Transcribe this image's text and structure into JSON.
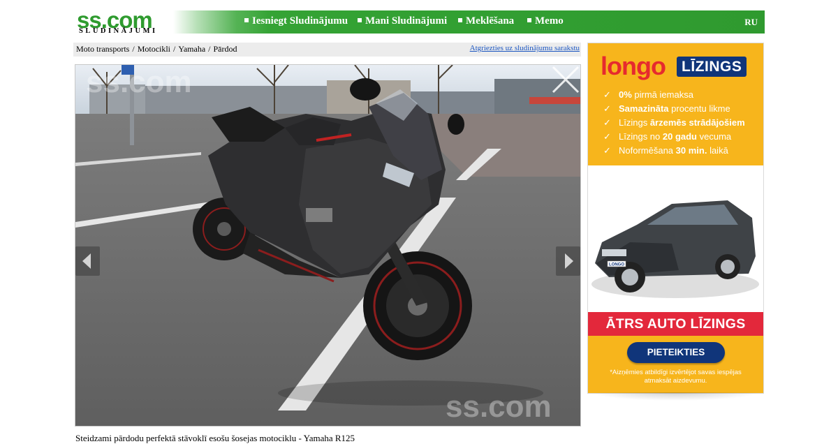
{
  "header": {
    "logo_text": "ss.com",
    "logo_subtitle": "SLUDINĀJUMI",
    "nav": [
      {
        "label": "Iesniegt Sludinājumu"
      },
      {
        "label": "Mani Sludinājumi"
      },
      {
        "label": "Meklēšana"
      },
      {
        "label": "Memo"
      }
    ],
    "language": "RU"
  },
  "breadcrumb": {
    "items": [
      "Moto transports",
      "Motocikli",
      "Yamaha",
      "Pārdod"
    ],
    "separator": "/",
    "back_link": "Atgriezties uz sludinājumu sarakstu"
  },
  "photo": {
    "subject": "black Yamaha R125 sport motorcycle in a parking lot",
    "watermark": "ss.com",
    "close_icon": "close-icon",
    "prev_icon": "chevron-left-icon",
    "next_icon": "chevron-right-icon"
  },
  "listing": {
    "description": "Steidzami pārdodu perfektā stāvoklī esošu šosejas motociklu - Yamaha R125"
  },
  "ad": {
    "brand": "longo",
    "badge": "LĪZINGS",
    "features": [
      {
        "bold": "0%",
        "text": " pirmā iemaksa"
      },
      {
        "bold": "Samazināta",
        "text": " procentu likme"
      },
      {
        "text": "Līzings ",
        "bold": "ārzemēs strādājošiem"
      },
      {
        "text": "Līzings no ",
        "bold": "20 gadu",
        "text2": " vecuma"
      },
      {
        "text": "Noformēšana ",
        "bold": "30 min.",
        "text2": " laikā"
      }
    ],
    "car_plate": "LONGO",
    "headline": "ĀTRS AUTO LĪZINGS",
    "button": "PIETEIKTIES",
    "note": "*Aizņēmies atbildīgi izvērtējot savas iespējas atmaksāt aizdevumu.",
    "colors": {
      "background": "#f7b51c",
      "brand": "#e62a2e",
      "navy": "#10357a",
      "strip": "#e3283b"
    }
  },
  "colors": {
    "nav_green": "#2f9a2f",
    "link_blue": "#1a55c0",
    "crumb_bg": "#ececec"
  }
}
